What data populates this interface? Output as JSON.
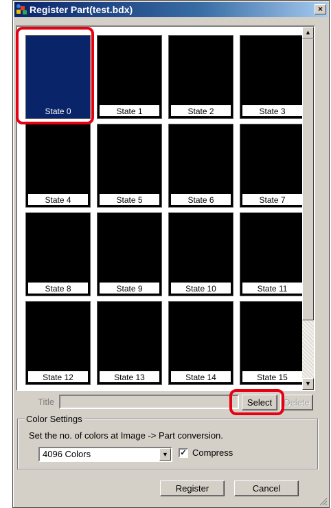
{
  "window": {
    "title": "Register Part(test.bdx)",
    "close_symbol": "×"
  },
  "states": [
    "State 0",
    "State 1",
    "State 2",
    "State 3",
    "State 4",
    "State 5",
    "State 6",
    "State 7",
    "State 8",
    "State 9",
    "State 10",
    "State 11",
    "State 12",
    "State 13",
    "State 14",
    "State 15"
  ],
  "selected_state": "State 0",
  "title_row": {
    "label": "Title",
    "value": ""
  },
  "buttons": {
    "select": "Select",
    "delete": "Delete",
    "register": "Register",
    "cancel": "Cancel"
  },
  "color_settings": {
    "legend": "Color Settings",
    "description": "Set the no. of colors at Image -> Part conversion.",
    "selected": "4096 Colors",
    "compress_label": "Compress",
    "compress_checked": true
  },
  "scrollbar": {
    "up_symbol": "▲",
    "down_symbol": "▼"
  },
  "colors": {
    "selected_tile": "#0a246a",
    "highlight": "#e60012",
    "window_bg": "#d4d0c8"
  }
}
